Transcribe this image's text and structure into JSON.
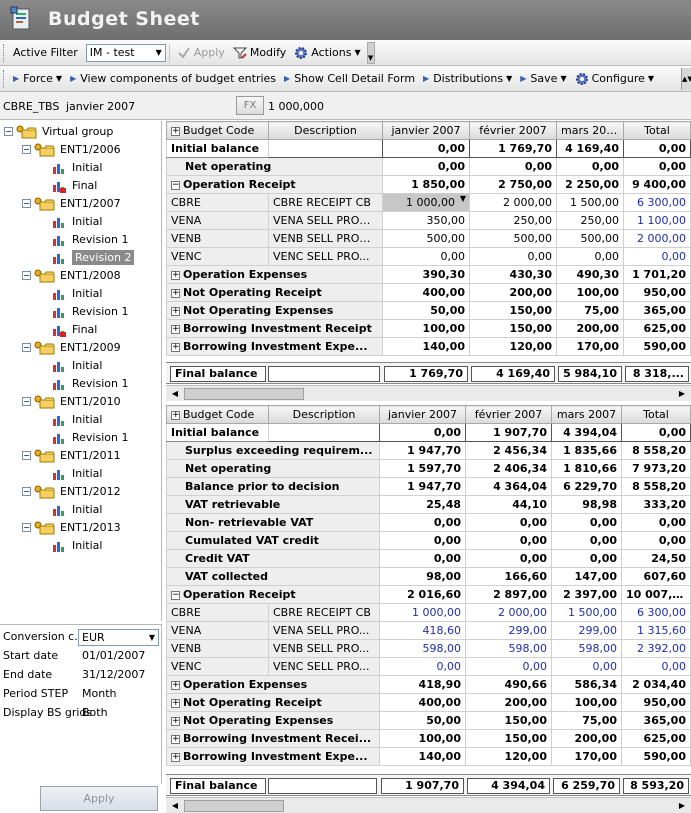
{
  "app": {
    "title": "Budget Sheet"
  },
  "toolbar1": {
    "active_filter_label": "Active Filter",
    "active_filter_value": "IM - test",
    "apply": "Apply",
    "modify": "Modify",
    "actions": "Actions"
  },
  "toolbar2": {
    "force": "Force",
    "view_components": "View components of budget entries",
    "show_cell_detail": "Show Cell Detail Form",
    "distributions": "Distributions",
    "save": "Save",
    "configure": "Configure"
  },
  "cellbar": {
    "ref": "CBRE_TBS",
    "date": "janvier 2007",
    "fx": "FX",
    "value": "1 000,000"
  },
  "tree": {
    "root": "Virtual group",
    "groups": [
      {
        "name": "ENT1/2006",
        "items": [
          "Initial",
          "Final"
        ]
      },
      {
        "name": "ENT1/2007",
        "items": [
          "Initial",
          "Revision 1",
          "Revision 2"
        ]
      },
      {
        "name": "ENT1/2008",
        "items": [
          "Initial",
          "Revision 1",
          "Final"
        ]
      },
      {
        "name": "ENT1/2009",
        "items": [
          "Initial",
          "Revision 1"
        ]
      },
      {
        "name": "ENT1/2010",
        "items": [
          "Initial",
          "Revision 1"
        ]
      },
      {
        "name": "ENT1/2011",
        "items": [
          "Initial"
        ]
      },
      {
        "name": "ENT1/2012",
        "items": [
          "Initial"
        ]
      },
      {
        "name": "ENT1/2013",
        "items": [
          "Initial"
        ]
      }
    ],
    "selected": "Revision 2"
  },
  "props": {
    "conversion_label": "Conversion c...",
    "conversion_value": "EUR",
    "start_label": "Start date",
    "start_value": "01/01/2007",
    "end_label": "End date",
    "end_value": "31/12/2007",
    "period_label": "Period STEP",
    "period_value": "Month",
    "display_label": "Display BS grids",
    "display_value": "Both",
    "apply": "Apply"
  },
  "grid_headers": [
    "Budget Code",
    "Description",
    "janvier 2007",
    "février 2007",
    "mars 2007",
    "Total"
  ],
  "grid1": {
    "rows": [
      {
        "type": "init",
        "code": "Initial balance",
        "desc": "",
        "v": [
          "0,00",
          "1 769,70",
          "4 169,40",
          "0,00"
        ]
      },
      {
        "type": "sub",
        "code": "Net operating",
        "desc": "",
        "v": [
          "0,00",
          "0,00",
          "0,00",
          "0,00"
        ]
      },
      {
        "type": "grp",
        "exp": "−",
        "code": "Operation Receipt",
        "desc": "",
        "v": [
          "1 850,00",
          "2 750,00",
          "2 250,00",
          "9 400,00"
        ]
      },
      {
        "type": "child",
        "code": "CBRE",
        "desc": "CBRE RECEIPT CB",
        "v": [
          "1 000,00",
          "2 000,00",
          "1 500,00",
          "6 300,00"
        ],
        "sel": true
      },
      {
        "type": "child",
        "code": "VENA",
        "desc": "VENA SELL PROD...",
        "v": [
          "350,00",
          "250,00",
          "250,00",
          "1 100,00"
        ]
      },
      {
        "type": "child",
        "code": "VENB",
        "desc": "VENB SELL PROD...",
        "v": [
          "500,00",
          "500,00",
          "500,00",
          "2 000,00"
        ]
      },
      {
        "type": "child",
        "code": "VENC",
        "desc": "VENC SELL PRO...",
        "v": [
          "0,00",
          "0,00",
          "0,00",
          "0,00"
        ]
      },
      {
        "type": "grp",
        "exp": "+",
        "code": "Operation Expenses",
        "desc": "",
        "v": [
          "390,30",
          "430,30",
          "490,30",
          "1 701,20"
        ]
      },
      {
        "type": "grp",
        "exp": "+",
        "code": "Not Operating Receipt",
        "desc": "",
        "v": [
          "400,00",
          "200,00",
          "100,00",
          "950,00"
        ]
      },
      {
        "type": "grp",
        "exp": "+",
        "code": "Not Operating Expenses",
        "desc": "",
        "v": [
          "50,00",
          "150,00",
          "75,00",
          "365,00"
        ]
      },
      {
        "type": "grp",
        "exp": "+",
        "code": "Borrowing Investment Receipt",
        "desc": "",
        "v": [
          "100,00",
          "150,00",
          "200,00",
          "625,00"
        ]
      },
      {
        "type": "grp",
        "exp": "+",
        "code": "Borrowing Investment Expe...",
        "desc": "",
        "v": [
          "140,00",
          "120,00",
          "170,00",
          "590,00"
        ]
      }
    ],
    "final": {
      "label": "Final balance",
      "v": [
        "1 769,70",
        "4 169,40",
        "5 984,10",
        "8 318,..."
      ]
    }
  },
  "grid2": {
    "rows": [
      {
        "type": "init",
        "code": "Initial balance",
        "desc": "",
        "v": [
          "0,00",
          "1 907,70",
          "4 394,04",
          "0,00"
        ]
      },
      {
        "type": "sub",
        "code": "Surplus exceeding requirem...",
        "desc": "",
        "v": [
          "1 947,70",
          "2 456,34",
          "1 835,66",
          "8 558,20"
        ]
      },
      {
        "type": "sub",
        "code": "Net operating",
        "desc": "",
        "v": [
          "1 597,70",
          "2 406,34",
          "1 810,66",
          "7 973,20"
        ]
      },
      {
        "type": "sub",
        "code": "Balance prior to decision",
        "desc": "",
        "v": [
          "1 947,70",
          "4 364,04",
          "6 229,70",
          "8 558,20"
        ]
      },
      {
        "type": "sub",
        "code": "VAT retrievable",
        "desc": "",
        "v": [
          "25,48",
          "44,10",
          "98,98",
          "333,20"
        ]
      },
      {
        "type": "sub",
        "code": "Non- retrievable VAT",
        "desc": "",
        "v": [
          "0,00",
          "0,00",
          "0,00",
          "0,00"
        ]
      },
      {
        "type": "sub",
        "code": "Cumulated VAT credit",
        "desc": "",
        "v": [
          "0,00",
          "0,00",
          "0,00",
          "0,00"
        ]
      },
      {
        "type": "sub",
        "code": "Credit VAT",
        "desc": "",
        "v": [
          "0,00",
          "0,00",
          "0,00",
          "24,50"
        ]
      },
      {
        "type": "sub",
        "code": "VAT collected",
        "desc": "",
        "v": [
          "98,00",
          "166,60",
          "147,00",
          "607,60"
        ]
      },
      {
        "type": "grp",
        "exp": "−",
        "code": "Operation Receipt",
        "desc": "",
        "v": [
          "2 016,60",
          "2 897,00",
          "2 397,00",
          "10 007,60"
        ]
      },
      {
        "type": "child",
        "blue": true,
        "code": "CBRE",
        "desc": "CBRE RECEIPT CB",
        "v": [
          "1 000,00",
          "2 000,00",
          "1 500,00",
          "6 300,00"
        ]
      },
      {
        "type": "child",
        "blue": true,
        "code": "VENA",
        "desc": "VENA SELL PRO...",
        "v": [
          "418,60",
          "299,00",
          "299,00",
          "1 315,60"
        ]
      },
      {
        "type": "child",
        "blue": true,
        "code": "VENB",
        "desc": "VENB SELL PRO...",
        "v": [
          "598,00",
          "598,00",
          "598,00",
          "2 392,00"
        ]
      },
      {
        "type": "child",
        "blue": true,
        "code": "VENC",
        "desc": "VENC SELL PRO...",
        "v": [
          "0,00",
          "0,00",
          "0,00",
          "0,00"
        ]
      },
      {
        "type": "grp",
        "exp": "+",
        "code": "Operation Expenses",
        "desc": "",
        "v": [
          "418,90",
          "490,66",
          "586,34",
          "2 034,40"
        ]
      },
      {
        "type": "grp",
        "exp": "+",
        "code": "Not Operating Receipt",
        "desc": "",
        "v": [
          "400,00",
          "200,00",
          "100,00",
          "950,00"
        ]
      },
      {
        "type": "grp",
        "exp": "+",
        "code": "Not Operating Expenses",
        "desc": "",
        "v": [
          "50,00",
          "150,00",
          "75,00",
          "365,00"
        ]
      },
      {
        "type": "grp",
        "exp": "+",
        "code": "Borrowing Investment Recei...",
        "desc": "",
        "v": [
          "100,00",
          "150,00",
          "200,00",
          "625,00"
        ]
      },
      {
        "type": "grp",
        "exp": "+",
        "code": "Borrowing Investment Expe...",
        "desc": "",
        "v": [
          "140,00",
          "120,00",
          "170,00",
          "590,00"
        ]
      }
    ],
    "final": {
      "label": "Final balance",
      "v": [
        "1 907,70",
        "4 394,04",
        "6 259,70",
        "8 593,20"
      ]
    }
  },
  "icons": {
    "title": "budget-sheet-icon",
    "modify": "modify-icon",
    "actions": "gear-icon",
    "configure": "gear-icon"
  },
  "colors": {
    "titlebar": "#7a7a7a",
    "blue_values": "#1f2fa8",
    "selected_cell": "#c7c7c7"
  }
}
